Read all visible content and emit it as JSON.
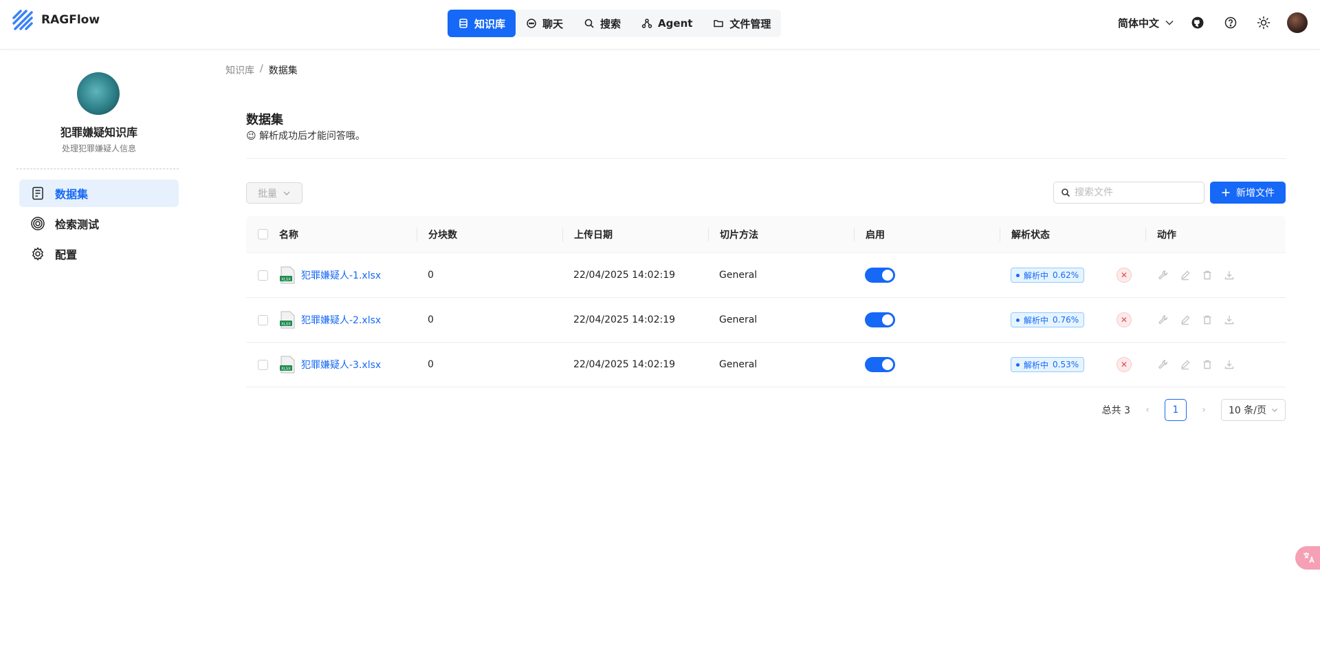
{
  "app": {
    "name": "RAGFlow"
  },
  "topnav": [
    {
      "label": "知识库",
      "icon": "database-icon",
      "active": true
    },
    {
      "label": "聊天",
      "icon": "chat-icon"
    },
    {
      "label": "搜索",
      "icon": "search-icon"
    },
    {
      "label": "Agent",
      "icon": "agent-icon"
    },
    {
      "label": "文件管理",
      "icon": "folder-icon"
    }
  ],
  "header": {
    "language": "简体中文"
  },
  "sidebar": {
    "kb_name": "犯罪嫌疑知识库",
    "kb_desc": "处理犯罪嫌疑人信息",
    "items": [
      {
        "label": "数据集",
        "icon": "document-icon",
        "active": true
      },
      {
        "label": "检索测试",
        "icon": "target-icon"
      },
      {
        "label": "配置",
        "icon": "gear-icon"
      }
    ]
  },
  "breadcrumb": {
    "root": "知识库",
    "separator": "/",
    "current": "数据集"
  },
  "page": {
    "title": "数据集",
    "subtitle_emoji": "😉",
    "subtitle": "解析成功后才能问答哦。"
  },
  "toolbar": {
    "batch_label": "批量",
    "search_placeholder": "搜索文件",
    "add_label": "新增文件"
  },
  "table": {
    "columns": [
      "名称",
      "分块数",
      "上传日期",
      "切片方法",
      "启用",
      "解析状态",
      "动作"
    ],
    "rows": [
      {
        "name": "犯罪嫌疑人-1.xlsx",
        "chunks": "0",
        "date": "22/04/2025 14:02:19",
        "method": "General",
        "enabled": true,
        "status": "解析中",
        "progress": "0.62%"
      },
      {
        "name": "犯罪嫌疑人-2.xlsx",
        "chunks": "0",
        "date": "22/04/2025 14:02:19",
        "method": "General",
        "enabled": true,
        "status": "解析中",
        "progress": "0.76%"
      },
      {
        "name": "犯罪嫌疑人-3.xlsx",
        "chunks": "0",
        "date": "22/04/2025 14:02:19",
        "method": "General",
        "enabled": true,
        "status": "解析中",
        "progress": "0.53%"
      }
    ]
  },
  "pagination": {
    "total_label": "总共 3",
    "current_page": "1",
    "page_size": "10 条/页"
  },
  "colors": {
    "primary": "#1668f6",
    "active_bg": "#e6f1fd"
  }
}
